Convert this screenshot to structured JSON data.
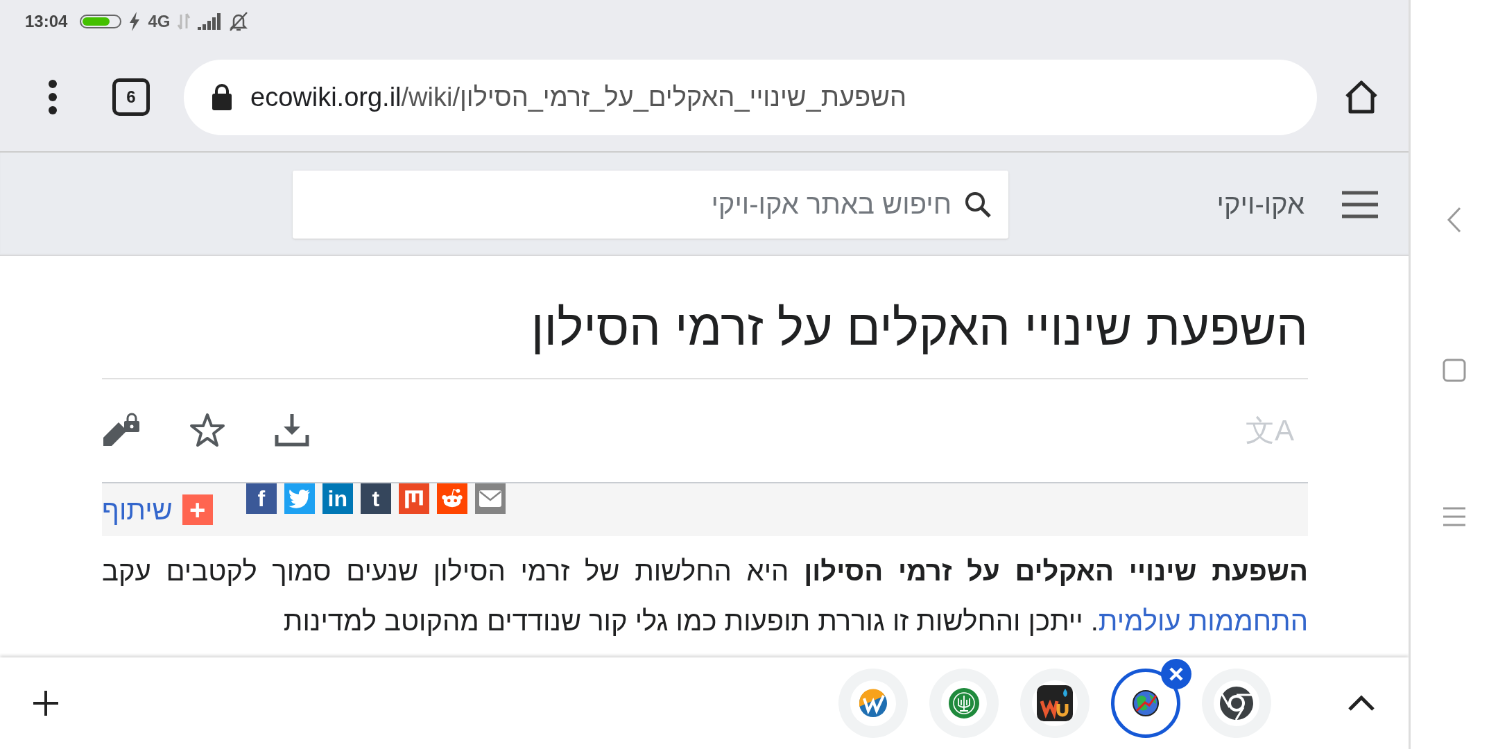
{
  "status_bar": {
    "time": "13:04",
    "network": "4G",
    "battery": {
      "level": 0.75
    }
  },
  "toolbar": {
    "tab_count": "6",
    "url_host": "ecowiki.org.il",
    "url_path": "/wiki/השפעת_שינויי_האקלים_על_זרמי_הסילון"
  },
  "site_header": {
    "site_name": "אקו-ויקי",
    "search": {
      "placeholder": "חיפוש באתר אקו-ויקי"
    }
  },
  "article": {
    "title": "השפעת שינויי האקלים על זרמי הסילון",
    "translate_glyph": "文A",
    "share": {
      "label": "שיתוף",
      "plus": "+",
      "buttons": [
        {
          "kind": "email",
          "color": "#848484"
        },
        {
          "kind": "reddit",
          "color": "#ff4500"
        },
        {
          "kind": "mix",
          "color": "#eb4924"
        },
        {
          "kind": "tumblr",
          "color": "#35465c",
          "glyph": "t"
        },
        {
          "kind": "linkedin",
          "color": "#0077b5",
          "glyph": "in"
        },
        {
          "kind": "twitter",
          "color": "#1da1f2"
        },
        {
          "kind": "facebook",
          "color": "#3b5998",
          "glyph": "f"
        }
      ]
    },
    "paragraph": {
      "lead": "**השפעת שינויי האקלים על זרמי הסילון** היא החלשות של זרמי הסילון שנעים סמוך לקטבים עקב",
      "link": "התחממות עולמית",
      "rest": ". ייתכן והחלשות זו גוררת תופעות כמו גלי קור שנודדים מהקוטב למדינות"
    }
  },
  "bottom_tabs": [
    {
      "kind": "w",
      "selected": false
    },
    {
      "kind": "emblem",
      "selected": false
    },
    {
      "kind": "wu",
      "selected": false
    },
    {
      "kind": "globe",
      "selected": true
    },
    {
      "kind": "chrome",
      "selected": false
    }
  ]
}
